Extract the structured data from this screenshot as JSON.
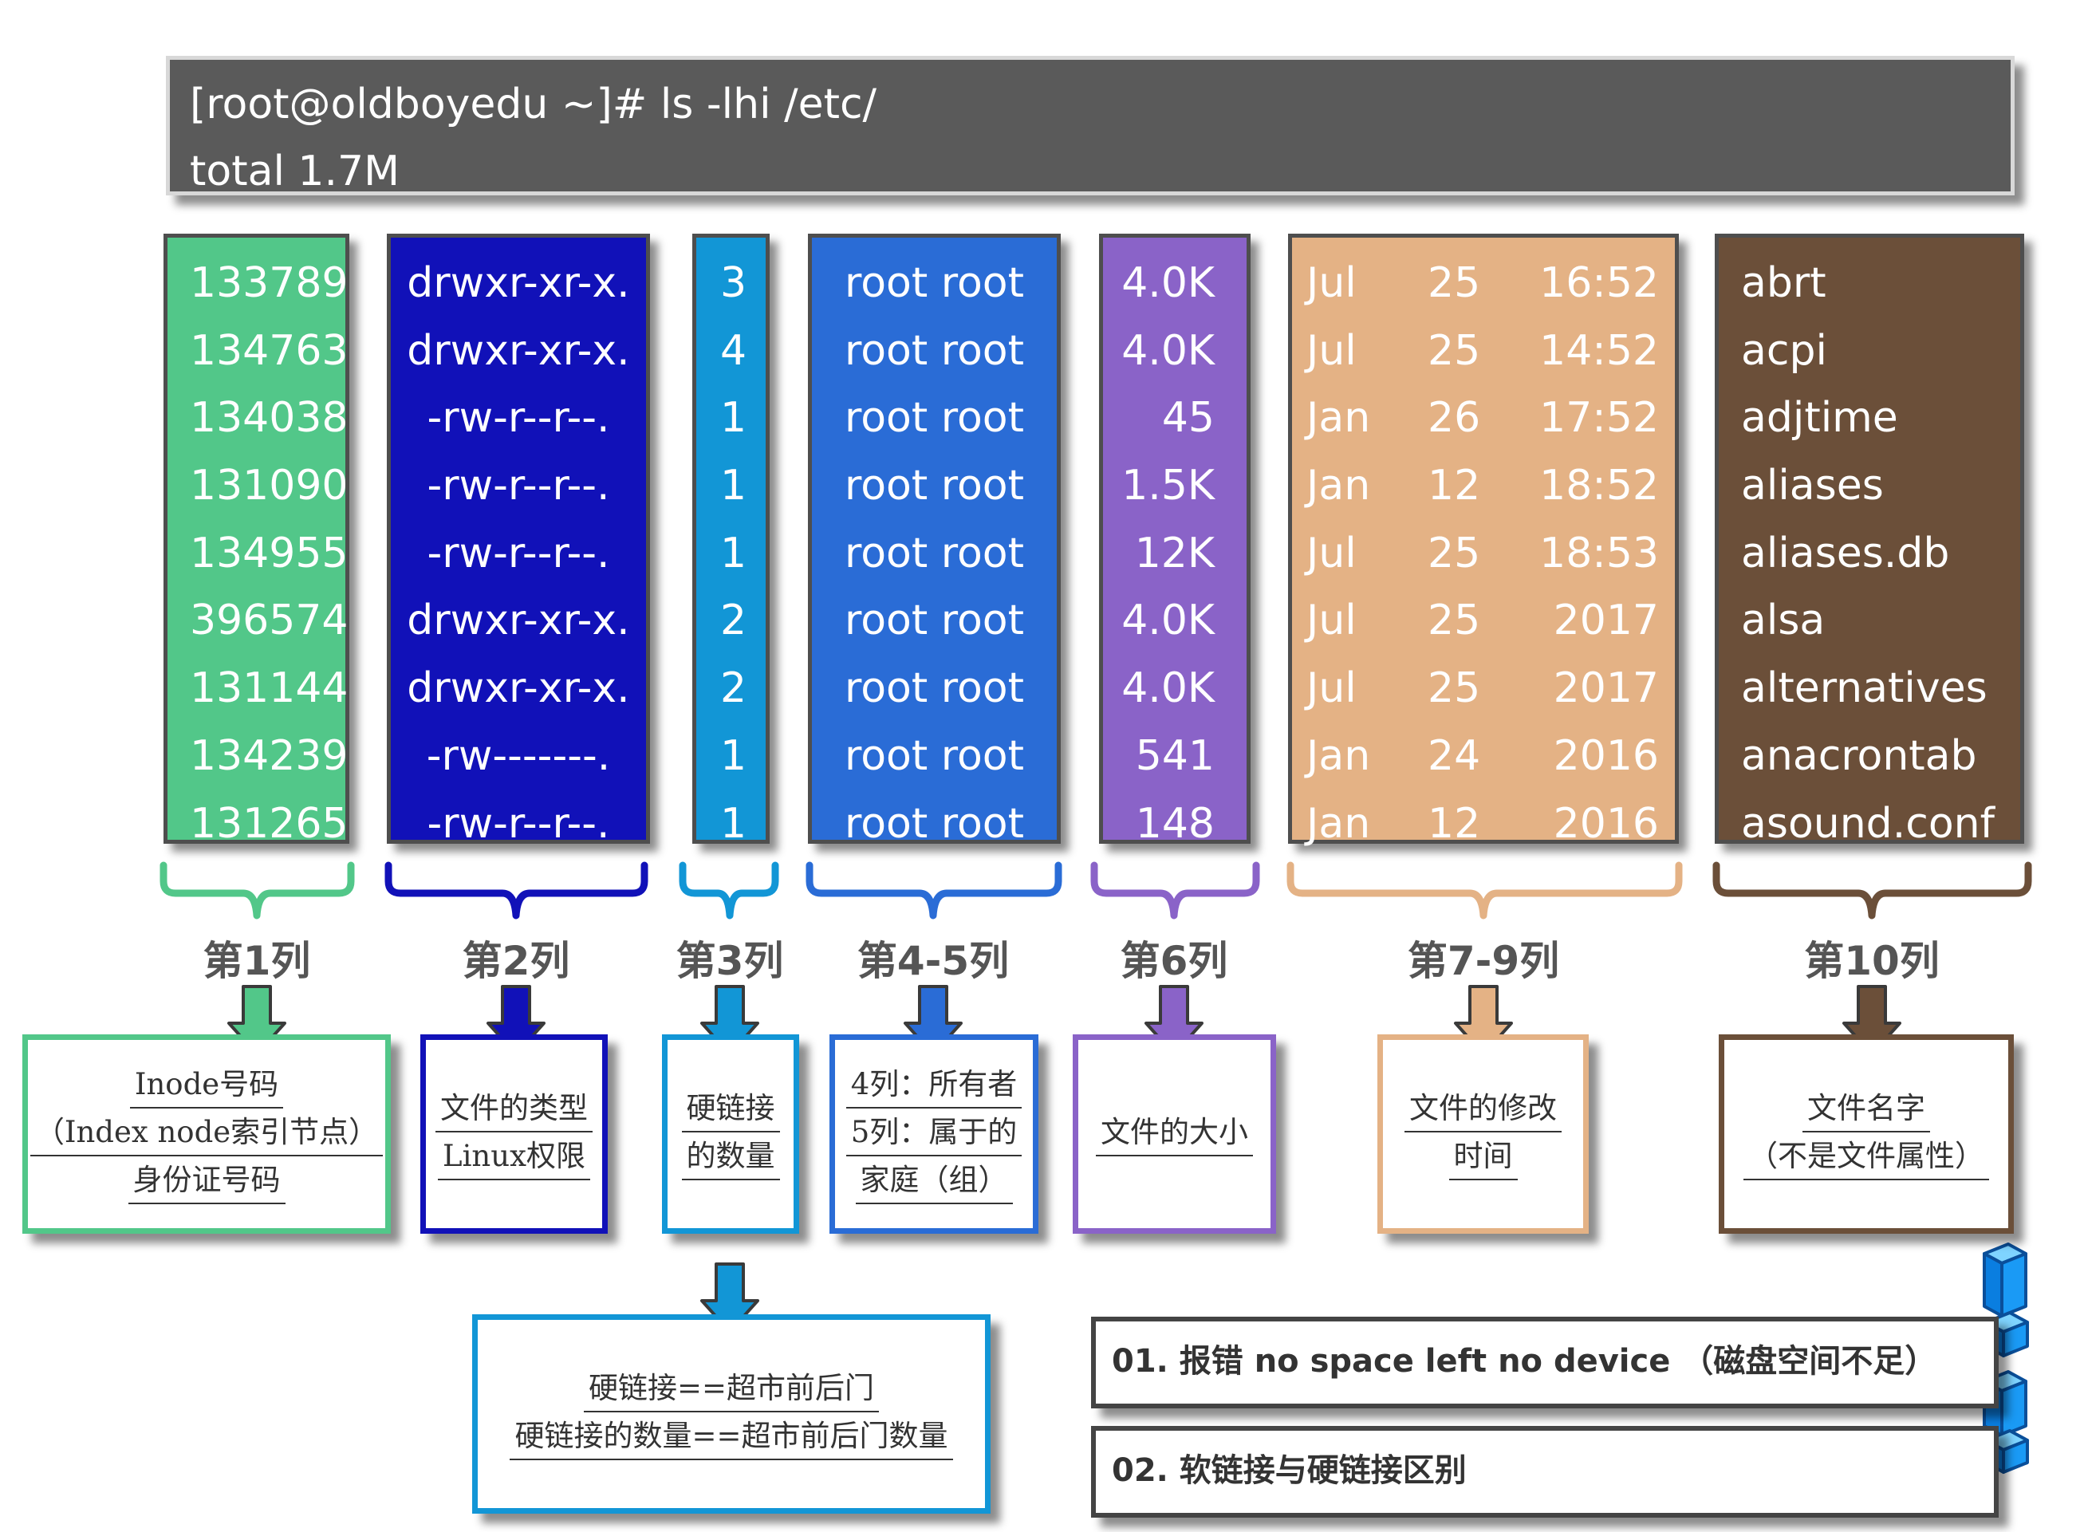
{
  "terminal": {
    "command": "[root@oldboyedu ~]# ls -lhi /etc/",
    "total": "total 1.7M"
  },
  "colors": {
    "inode": "#52c789",
    "perm": "#1111b8",
    "links": "#1296d6",
    "owner": "#2a6cd6",
    "size": "#8a63c8",
    "time": "#e4b285",
    "name": "#6b4f39"
  },
  "table": {
    "inode": [
      "133789",
      "134763",
      "134038",
      "131090",
      "134955",
      "396574",
      "131144",
      "134239",
      "131265"
    ],
    "perm": [
      "drwxr-xr-x.",
      "drwxr-xr-x.",
      "-rw-r--r--.",
      "-rw-r--r--.",
      "-rw-r--r--.",
      "drwxr-xr-x.",
      "drwxr-xr-x.",
      "-rw-------.",
      "-rw-r--r--."
    ],
    "links": [
      "3",
      "4",
      "1",
      "1",
      "1",
      "2",
      "2",
      "1",
      "1"
    ],
    "owner": [
      "root root",
      "root root",
      "root root",
      "root root",
      "root root",
      "root root",
      "root root",
      "root root",
      "root root"
    ],
    "size": [
      "4.0K",
      "4.0K",
      "45",
      "1.5K",
      "12K",
      "4.0K",
      "4.0K",
      "541",
      "148"
    ],
    "month": [
      "Jul",
      "Jul",
      "Jan",
      "Jan",
      "Jul",
      "Jul",
      "Jul",
      "Jan",
      "Jan"
    ],
    "day": [
      "25",
      "25",
      "26",
      "12",
      "25",
      "25",
      "25",
      "24",
      "12"
    ],
    "clock": [
      "16:52",
      "14:52",
      "17:52",
      "18:52",
      "18:53",
      "2017",
      "2017",
      "2016",
      "2016"
    ],
    "name": [
      "abrt",
      "acpi",
      "adjtime",
      "aliases",
      "aliases.db",
      "alsa",
      "alternatives",
      "anacrontab",
      "asound.conf"
    ]
  },
  "labels": {
    "c1": "第1列",
    "c2": "第2列",
    "c3": "第3列",
    "c45": "第4-5列",
    "c6": "第6列",
    "c79": "第7-9列",
    "c10": "第10列"
  },
  "descriptions": {
    "inode": [
      "Inode号码",
      "（Index node索引节点）",
      "身份证号码"
    ],
    "perm": [
      "文件的类型",
      "Linux权限"
    ],
    "links": [
      "硬链接",
      "的数量"
    ],
    "owner": [
      "4列：所有者",
      "5列：属于的",
      "家庭（组）"
    ],
    "size": [
      "文件的大小"
    ],
    "time": [
      "文件的修改",
      "时间"
    ],
    "name": [
      "文件名字",
      "（不是文件属性）"
    ],
    "hardlink": [
      "硬链接==超市前后门",
      "硬链接的数量==超市前后门数量"
    ]
  },
  "notes": {
    "n1": "01. 报错 no space left no device （磁盘空间不足）",
    "n2": "02. 软链接与硬链接区别"
  }
}
